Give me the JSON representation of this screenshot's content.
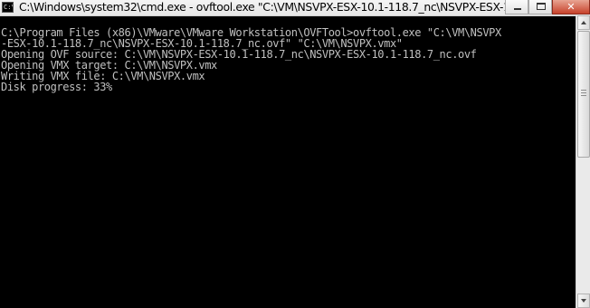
{
  "window": {
    "title": "C:\\Windows\\system32\\cmd.exe - ovftool.exe  \"C:\\VM\\NSVPX-ESX-10.1-118.7_nc\\NSVPX-ESX-10.1-...",
    "icon_name": "cmd-icon",
    "icon_label": "C:\\"
  },
  "controls": {
    "minimize": "minimize-icon",
    "maximize": "maximize-icon",
    "close_label": "✕"
  },
  "console": {
    "background": "#000000",
    "foreground": "#c0c0c0",
    "lines": [
      "C:\\Program Files (x86)\\VMware\\VMware Workstation\\OVFTool>ovftool.exe \"C:\\VM\\NSVPX",
      "-ESX-10.1-118.7_nc\\NSVPX-ESX-10.1-118.7_nc.ovf\" \"C:\\VM\\NSVPX.vmx\"",
      "Opening OVF source: C:\\VM\\NSVPX-ESX-10.1-118.7_nc\\NSVPX-ESX-10.1-118.7_nc.ovf",
      "Opening VMX target: C:\\VM\\NSVPX.vmx",
      "Writing VMX file: C:\\VM\\NSVPX.vmx",
      "Disk progress: 33%"
    ]
  }
}
